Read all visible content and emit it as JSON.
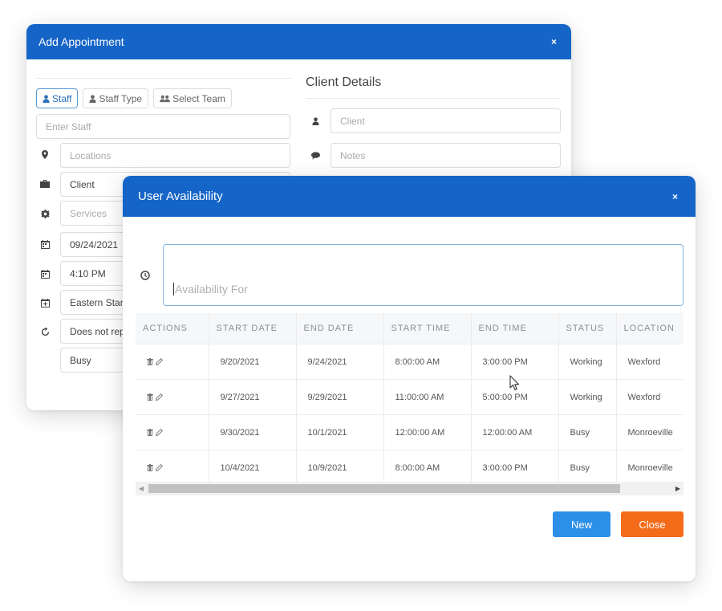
{
  "appointment": {
    "title": "Add Appointment",
    "close_glyph": "×",
    "staff_tabs": [
      {
        "label": "Staff",
        "icon": "user-icon",
        "active": true
      },
      {
        "label": "Staff Type",
        "icon": "user-icon",
        "active": false
      },
      {
        "label": "Select Team",
        "icon": "users-icon",
        "active": false
      }
    ],
    "fields": {
      "staff_placeholder": "Enter Staff",
      "locations_placeholder": "Locations",
      "client_value": "Client",
      "services_placeholder": "Services",
      "date_value": "09/24/2021",
      "time_value": "4:10 PM",
      "timezone_value": "Eastern Stan",
      "repeat_value": "Does not rep",
      "status_value": "Busy"
    },
    "client_details": {
      "title": "Client Details",
      "client_placeholder": "Client",
      "notes_placeholder": "Notes"
    }
  },
  "availability": {
    "title": "User Availability",
    "close_glyph": "×",
    "input_placeholder": "Availability For",
    "columns": [
      "ACTIONS",
      "START DATE",
      "END DATE",
      "START TIME",
      "END TIME",
      "STATUS",
      "LOCATION"
    ],
    "rows": [
      {
        "start_date": "9/20/2021",
        "end_date": "9/24/2021",
        "start_time": "8:00:00 AM",
        "end_time": "3:00:00 PM",
        "status": "Working",
        "location": "Wexford"
      },
      {
        "start_date": "9/27/2021",
        "end_date": "9/29/2021",
        "start_time": "11:00:00 AM",
        "end_time": "5:00:00 PM",
        "status": "Working",
        "location": "Wexford"
      },
      {
        "start_date": "9/30/2021",
        "end_date": "10/1/2021",
        "start_time": "12:00:00 AM",
        "end_time": "12:00:00 AM",
        "status": "Busy",
        "location": "Monroeville"
      },
      {
        "start_date": "10/4/2021",
        "end_date": "10/9/2021",
        "start_time": "8:00:00 AM",
        "end_time": "3:00:00 PM",
        "status": "Busy",
        "location": "Monroeville"
      }
    ],
    "buttons": {
      "new": "New",
      "close": "Close"
    },
    "colors": {
      "header": "#1565c8",
      "new_button": "#2c8fe8",
      "close_button": "#f46b1a"
    }
  }
}
